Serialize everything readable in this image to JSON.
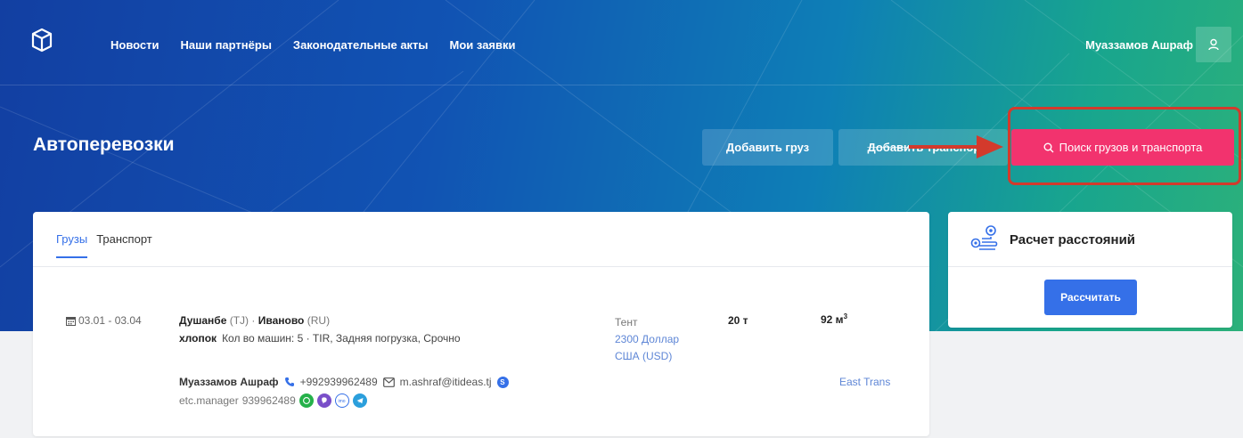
{
  "nav": {
    "links": [
      "Новости",
      "Наши партнёры",
      "Законодательные акты",
      "Мои заявки"
    ],
    "user_name": "Муаззамов Ашраф"
  },
  "page": {
    "title": "Автоперевозки"
  },
  "actions": {
    "add_cargo": "Добавить груз",
    "add_transport": "Добавить транспорт",
    "search": "Поиск грузов и транспорта"
  },
  "tabs": {
    "cargo": "Грузы",
    "transport": "Транспорт"
  },
  "listing": {
    "date_range": "03.01 - 03.04",
    "from_city": "Душанбе",
    "from_code": "(TJ)",
    "separator": " · ",
    "to_city": "Иваново",
    "to_code": "(RU)",
    "cargo_name": "хлопок",
    "details": "Кол во машин: 5 · TIR, Задняя погрузка, Срочно",
    "body_type": "Тент",
    "price_line1": "2300 Доллар",
    "price_line2": "США (USD)",
    "weight": "20 т",
    "volume": "92 м",
    "volume_sup": "3",
    "contact_name": "Муаззамов Ашраф",
    "phone": "+992939962489",
    "email": "m.ashraf@itideas.tj",
    "skype": "etc.manager",
    "messenger_number": "939962489",
    "company": "East Trans"
  },
  "sidebar": {
    "title": "Расчет расстояний",
    "calc_button": "Рассчитать"
  },
  "colors": {
    "accent_pink": "#f2336e",
    "primary_blue": "#3570e8",
    "highlight_red": "#d33a2c"
  }
}
